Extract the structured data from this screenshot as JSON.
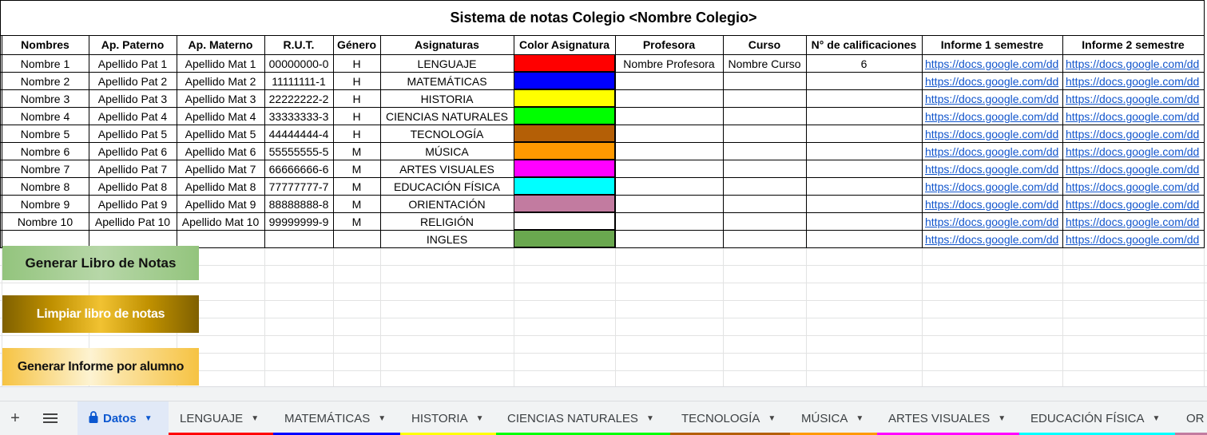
{
  "title": "Sistema de notas Colegio <Nombre Colegio>",
  "columns": [
    "Nombres",
    "Ap. Paterno",
    "Ap. Materno",
    "R.U.T.",
    "Género",
    "Asignaturas",
    "Color Asignatura",
    "Profesora",
    "Curso",
    "N° de calificaciones",
    "Informe 1 semestre",
    "Informe 2 semestre"
  ],
  "rows": [
    {
      "nombre": "Nombre 1",
      "pat": "Apellido Pat 1",
      "mat": "Apellido Mat 1",
      "rut": "00000000-0",
      "genero": "H",
      "asignatura": "LENGUAJE",
      "color": "#ff0000",
      "profesora": "Nombre Profesora",
      "curso": "Nombre Curso",
      "calif": "6",
      "inf1": "https://docs.google.com/dd",
      "inf2": "https://docs.google.com/dd"
    },
    {
      "nombre": "Nombre 2",
      "pat": "Apellido Pat 2",
      "mat": "Apellido Mat 2",
      "rut": "11111111-1",
      "genero": "H",
      "asignatura": "MATEMÁTICAS",
      "color": "#0000ff",
      "profesora": "",
      "curso": "",
      "calif": "",
      "inf1": "https://docs.google.com/dd",
      "inf2": "https://docs.google.com/dd"
    },
    {
      "nombre": "Nombre 3",
      "pat": "Apellido Pat 3",
      "mat": "Apellido Mat 3",
      "rut": "22222222-2",
      "genero": "H",
      "asignatura": "HISTORIA",
      "color": "#ffff00",
      "profesora": "",
      "curso": "",
      "calif": "",
      "inf1": "https://docs.google.com/dd",
      "inf2": "https://docs.google.com/dd"
    },
    {
      "nombre": "Nombre 4",
      "pat": "Apellido Pat 4",
      "mat": "Apellido Mat 4",
      "rut": "33333333-3",
      "genero": "H",
      "asignatura": "CIENCIAS NATURALES",
      "color": "#00ff00",
      "profesora": "",
      "curso": "",
      "calif": "",
      "inf1": "https://docs.google.com/dd",
      "inf2": "https://docs.google.com/dd"
    },
    {
      "nombre": "Nombre 5",
      "pat": "Apellido Pat 5",
      "mat": "Apellido Mat 5",
      "rut": "44444444-4",
      "genero": "H",
      "asignatura": "TECNOLOGÍA",
      "color": "#b45f06",
      "profesora": "",
      "curso": "",
      "calif": "",
      "inf1": "https://docs.google.com/dd",
      "inf2": "https://docs.google.com/dd"
    },
    {
      "nombre": "Nombre 6",
      "pat": "Apellido Pat 6",
      "mat": "Apellido Mat 6",
      "rut": "55555555-5",
      "genero": "M",
      "asignatura": "MÚSICA",
      "color": "#ff9900",
      "profesora": "",
      "curso": "",
      "calif": "",
      "inf1": "https://docs.google.com/dd",
      "inf2": "https://docs.google.com/dd"
    },
    {
      "nombre": "Nombre 7",
      "pat": "Apellido Pat 7",
      "mat": "Apellido Mat 7",
      "rut": "66666666-6",
      "genero": "M",
      "asignatura": "ARTES VISUALES",
      "color": "#ff00ff",
      "profesora": "",
      "curso": "",
      "calif": "",
      "inf1": "https://docs.google.com/dd",
      "inf2": "https://docs.google.com/dd"
    },
    {
      "nombre": "Nombre 8",
      "pat": "Apellido Pat 8",
      "mat": "Apellido Mat 8",
      "rut": "77777777-7",
      "genero": "M",
      "asignatura": "EDUCACIÓN FÍSICA",
      "color": "#00ffff",
      "profesora": "",
      "curso": "",
      "calif": "",
      "inf1": "https://docs.google.com/dd",
      "inf2": "https://docs.google.com/dd"
    },
    {
      "nombre": "Nombre 9",
      "pat": "Apellido Pat 9",
      "mat": "Apellido Mat 9",
      "rut": "88888888-8",
      "genero": "M",
      "asignatura": "ORIENTACIÓN",
      "color": "#c27ba0",
      "profesora": "",
      "curso": "",
      "calif": "",
      "inf1": "https://docs.google.com/dd",
      "inf2": "https://docs.google.com/dd"
    },
    {
      "nombre": "Nombre 10",
      "pat": "Apellido Pat 10",
      "mat": "Apellido Mat 10",
      "rut": "99999999-9",
      "genero": "M",
      "asignatura": "RELIGIÓN",
      "color": "#ffffff",
      "profesora": "",
      "curso": "",
      "calif": "",
      "inf1": "https://docs.google.com/dd",
      "inf2": "https://docs.google.com/dd"
    },
    {
      "nombre": "",
      "pat": "",
      "mat": "",
      "rut": "",
      "genero": "",
      "asignatura": "INGLES",
      "color": "#6aa84f",
      "profesora": "",
      "curso": "",
      "calif": "",
      "inf1": "https://docs.google.com/dd",
      "inf2": "https://docs.google.com/dd"
    }
  ],
  "buttons": {
    "generar": "Generar Libro de Notas",
    "limpiar": "Limpiar libro de notas",
    "informe": "Generar Informe por alumno"
  },
  "tabbar": {
    "add_icon": "plus-icon",
    "menu_icon": "hamburger-menu-icon",
    "tabs": [
      {
        "label": "Datos",
        "color": "#0b57d0",
        "active": true,
        "locked": true
      },
      {
        "label": "LENGUAJE",
        "color": "#ff0000"
      },
      {
        "label": "MATEMÁTICAS",
        "color": "#0000ff"
      },
      {
        "label": "HISTORIA",
        "color": "#ffff00"
      },
      {
        "label": "CIENCIAS NATURALES",
        "color": "#00ff00"
      },
      {
        "label": "TECNOLOGÍA",
        "color": "#b45f06"
      },
      {
        "label": "MÚSICA",
        "color": "#ff9900"
      },
      {
        "label": "ARTES VISUALES",
        "color": "#ff00ff"
      },
      {
        "label": "EDUCACIÓN FÍSICA",
        "color": "#00ffff"
      },
      {
        "label": "OR",
        "color": "#c27ba0"
      }
    ]
  }
}
